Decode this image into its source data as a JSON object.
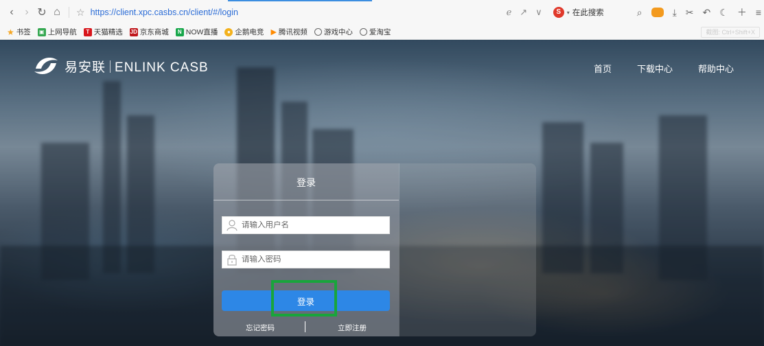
{
  "browser": {
    "url": "https://client.xpc.casbs.cn/client/#/login",
    "search_engine_label": "在此搜索",
    "shortcut_hint": "截图: Ctrl+Shift+X"
  },
  "bookmarks": [
    {
      "label": "书签",
      "icon": "star-icon",
      "color": "#f5a623"
    },
    {
      "label": "上网导航",
      "icon": "nav-icon",
      "color": "#36a852"
    },
    {
      "label": "天猫精选",
      "icon": "tmall-icon",
      "color": "#d8161c"
    },
    {
      "label": "京东商城",
      "icon": "jd-icon",
      "color": "#c0171c"
    },
    {
      "label": "NOW直播",
      "icon": "now-icon",
      "color": "#18a74b"
    },
    {
      "label": "企鹅电竞",
      "icon": "penguin-icon",
      "color": "#f3b11c"
    },
    {
      "label": "腾讯视频",
      "icon": "video-icon",
      "color": "#ff8a00"
    },
    {
      "label": "游戏中心",
      "icon": "globe-icon",
      "color": "#666666"
    },
    {
      "label": "爱淘宝",
      "icon": "globe-icon",
      "color": "#666666"
    }
  ],
  "site": {
    "brand_cn": "易安联",
    "brand_en": "ENLINK CASB",
    "nav": [
      "首页",
      "下载中心",
      "帮助中心"
    ]
  },
  "login": {
    "title": "登录",
    "username_placeholder": "请输入用户名",
    "password_placeholder": "请输入密码",
    "submit_label": "登录",
    "forgot_label": "忘记密码",
    "register_label": "立即注册",
    "accent_color": "#2d87e6",
    "highlight_color": "#18a53b"
  }
}
